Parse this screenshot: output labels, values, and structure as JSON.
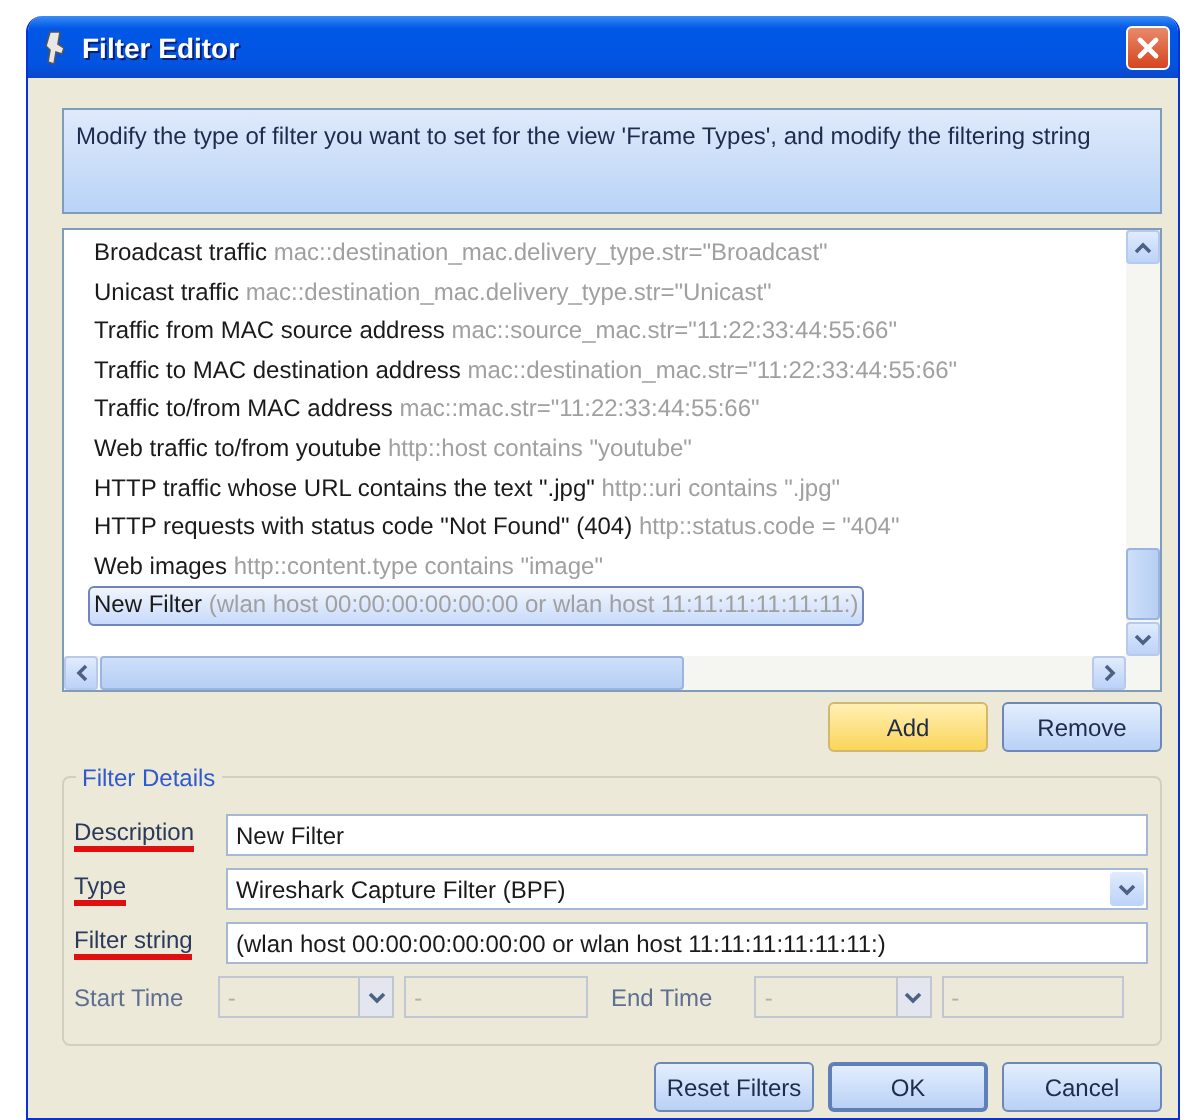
{
  "window": {
    "title": "Filter Editor"
  },
  "instructions": "Modify the type of filter you want to set for the view 'Frame Types', and modify the filtering string",
  "filters": [
    {
      "name": "Broadcast traffic",
      "expression": "mac::destination_mac.delivery_type.str=\"Broadcast\"",
      "selected": false
    },
    {
      "name": "Unicast traffic",
      "expression": "mac::destination_mac.delivery_type.str=\"Unicast\"",
      "selected": false
    },
    {
      "name": "Traffic from MAC source address",
      "expression": "mac::source_mac.str=\"11:22:33:44:55:66\"",
      "selected": false
    },
    {
      "name": "Traffic to MAC destination address",
      "expression": "mac::destination_mac.str=\"11:22:33:44:55:66\"",
      "selected": false
    },
    {
      "name": "Traffic to/from MAC address",
      "expression": "mac::mac.str=\"11:22:33:44:55:66\"",
      "selected": false
    },
    {
      "name": "Web traffic to/from youtube",
      "expression": "http::host contains \"youtube\"",
      "selected": false
    },
    {
      "name": "HTTP traffic whose URL contains the text \".jpg\"",
      "expression": "http::uri contains \".jpg\"",
      "selected": false
    },
    {
      "name": "HTTP requests with status code \"Not Found\" (404)",
      "expression": "http::status.code = \"404\"",
      "selected": false
    },
    {
      "name": "Web images",
      "expression": "http::content.type contains \"image\"",
      "selected": false
    },
    {
      "name": "New Filter",
      "expression": "(wlan host 00:00:00:00:00:00 or wlan host 11:11:11:11:11:11:)",
      "selected": true
    }
  ],
  "list_buttons": [
    {
      "label": "Add",
      "highlighted": true
    },
    {
      "label": "Remove",
      "highlighted": false
    }
  ],
  "details": {
    "title": "Filter Details",
    "fields": [
      {
        "kind": "text",
        "label": "Description",
        "value": "New Filter",
        "annotated": true
      },
      {
        "kind": "dropdown",
        "label": "Type",
        "value": "Wireshark Capture Filter (BPF)",
        "annotated": true
      },
      {
        "kind": "text",
        "label": "Filter string",
        "value": "(wlan host 00:00:00:00:00:00 or wlan host 11:11:11:11:11:11:)",
        "annotated": true
      }
    ],
    "time_ranges": [
      {
        "label": "Start Time",
        "date": "-",
        "time": "-",
        "disabled": true
      },
      {
        "label": "End Time",
        "date": "-",
        "time": "-",
        "disabled": true
      }
    ]
  },
  "buttons": [
    {
      "label": "Reset Filters",
      "default": false
    },
    {
      "label": "OK",
      "default": true
    },
    {
      "label": "Cancel",
      "default": false
    }
  ]
}
